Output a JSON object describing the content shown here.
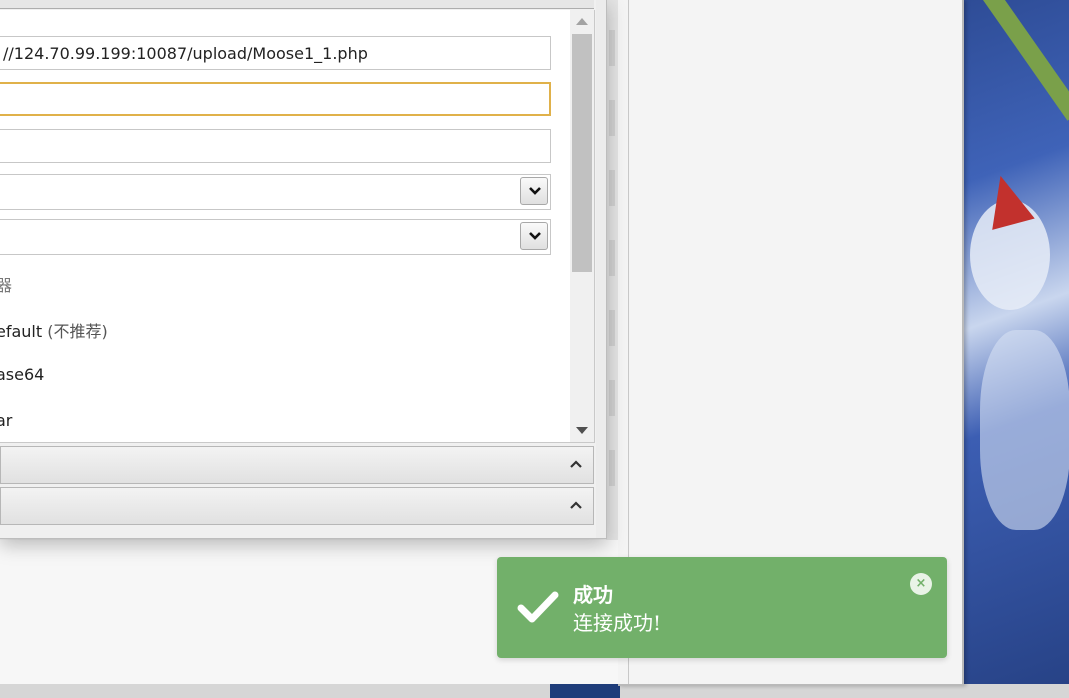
{
  "form": {
    "url_value": "//124.70.99.199:10087/upload/Moose1_1.php",
    "password_value": "",
    "third_field_value": "",
    "select1_value": "",
    "select2_value": ""
  },
  "encoder": {
    "label": "器",
    "options": [
      {
        "label": "efault",
        "suffix": " (不推荐)"
      },
      {
        "label": "ase64",
        "suffix": ""
      },
      {
        "label": "ar",
        "suffix": ""
      }
    ]
  },
  "toast": {
    "title": "成功",
    "message": "连接成功!",
    "close_glyph": "×",
    "color": "#72b06a"
  }
}
